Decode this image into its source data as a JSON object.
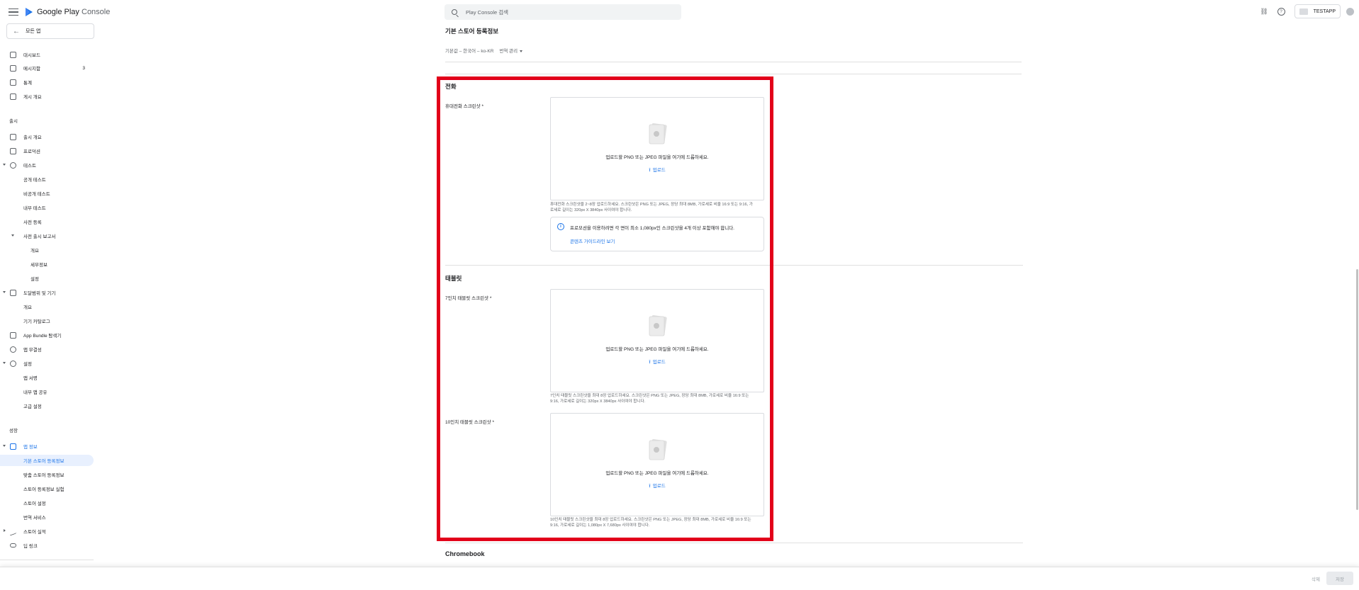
{
  "app": {
    "brand_prefix": "Google Play",
    "brand_suffix": "Console",
    "all_apps": "모든 앱"
  },
  "sidebar": {
    "top_items": [
      {
        "label": "대시보드"
      },
      {
        "label": "메시지함",
        "count": "3"
      },
      {
        "label": "통계"
      },
      {
        "label": "게시 개요"
      }
    ],
    "release_section": "출시",
    "release_items": [
      {
        "label": "출시 개요"
      },
      {
        "label": "프로덕션"
      },
      {
        "label": "테스트"
      },
      {
        "label": "공개 테스트"
      },
      {
        "label": "비공개 테스트"
      },
      {
        "label": "내부 테스트"
      },
      {
        "label": "사전 등록"
      },
      {
        "label": "사전 출시 보고서"
      },
      {
        "label": "개요"
      },
      {
        "label": "세부정보"
      },
      {
        "label": "설정"
      },
      {
        "label": "도달범위 및 기기"
      },
      {
        "label": "개요"
      },
      {
        "label": "기기 카탈로그"
      },
      {
        "label": "App Bundle 탐색기"
      },
      {
        "label": "앱 무결성"
      },
      {
        "label": "설정"
      },
      {
        "label": "앱 서명"
      },
      {
        "label": "내부 앱 공유"
      },
      {
        "label": "고급 설정"
      }
    ],
    "growth_section": "성장",
    "growth_items": [
      {
        "label": "앱 정보"
      },
      {
        "label": "기본 스토어 등록정보"
      },
      {
        "label": "맞춤 스토어 등록정보"
      },
      {
        "label": "스토어 등록정보 실험"
      },
      {
        "label": "스토어 설정"
      },
      {
        "label": "번역 서비스"
      },
      {
        "label": "스토어 실적"
      },
      {
        "label": "딥 링크"
      }
    ]
  },
  "topbar": {
    "search_placeholder": "Play Console 검색",
    "account": "TESTAPP",
    "help": "?"
  },
  "main": {
    "page_title": "기본 스토어 등록정보",
    "default_language": "기본값 – 한국어 – ko-KR",
    "manage_translations": "번역 관리",
    "phone": {
      "title": "전화",
      "label": "휴대전화 스크린샷 *",
      "drop_text": "업로드할 PNG 또는 JPEG 파일을 여기에 드롭하세요.",
      "upload": "업로드",
      "help_line1": "휴대전화 스크린샷을 2~8장 업로드하세요. 스크린샷은 PNG 또는 JPEG, 장당 최대 8MB, 가로세로 비율 16:9 또는 9:16, 가",
      "help_line2": "로세로 길이는 320px X 3840px 사이여야 합니다.",
      "info_text": "프로모션을 이용하려면 각 면이 최소 1,080px인 스크린샷을 4개 이상 포함해야 합니다.",
      "info_link": "콘텐츠 가이드라인 보기"
    },
    "tablet": {
      "title": "태블릿",
      "label7": "7인치 태블릿 스크린샷 *",
      "help7_line1": "7인치 태블릿 스크린샷을 최대 8장 업로드하세요. 스크린샷은 PNG 또는 JPEG, 장당 최대 8MB, 가로세로 비율 16:9 또는",
      "help7_line2": "9:16, 가로세로 길이는 320px X 3840px 사이여야 합니다.",
      "label10": "10인치 태블릿 스크린샷 *",
      "help10_line1": "10인치 태블릿 스크린샷을 최대 8장 업로드하세요. 스크린샷은 PNG 또는 JPEG, 장당 최대 8MB, 가로세로 비율 16:9 또는",
      "help10_line2": "9:16, 가로세로 길이는 1,080px X 7,680px 사이여야 합니다."
    },
    "chromebook_title": "Chromebook"
  },
  "bottom_bar": {
    "discard": "삭제",
    "save": "저장"
  },
  "colors": {
    "accent": "#1a73e8",
    "highlight": "#e2001a"
  }
}
